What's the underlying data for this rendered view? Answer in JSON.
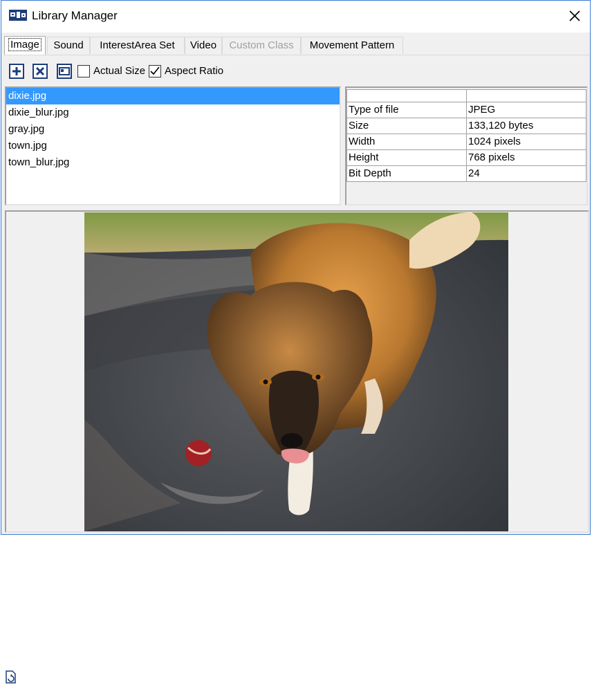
{
  "window": {
    "title": "Library Manager",
    "icons": {
      "app": "library-window-icon",
      "close": "close-icon"
    },
    "accent": "#3a7bd5"
  },
  "tabs": [
    {
      "label": "Image",
      "active": true
    },
    {
      "label": "Sound"
    },
    {
      "label": "InterestArea Set"
    },
    {
      "label": "Video"
    },
    {
      "label": "Custom Class",
      "disabled": true
    },
    {
      "label": "Movement Pattern"
    }
  ],
  "toolbar": {
    "add_icon": "plus-box-icon",
    "delete_icon": "x-box-icon",
    "view_icon": "window-icon",
    "actual_size_label": "Actual Size",
    "actual_size_checked": false,
    "aspect_ratio_label": "Aspect Ratio",
    "aspect_ratio_checked": true
  },
  "files": {
    "selected_index": 0,
    "selection_color": "#3399ff",
    "items": [
      "dixie.jpg",
      "dixie_blur.jpg",
      "gray.jpg",
      "town.jpg",
      "town_blur.jpg"
    ]
  },
  "properties": {
    "rows": [
      {
        "key": "Type of file",
        "value": "JPEG"
      },
      {
        "key": "Size",
        "value": "133,120 bytes"
      },
      {
        "key": "Width",
        "value": "1024 pixels"
      },
      {
        "key": "Height",
        "value": "768 pixels"
      },
      {
        "key": "Bit Depth",
        "value": "24"
      }
    ]
  },
  "preview": {
    "subject": "dog-photo"
  },
  "taskbar": {
    "icon": "document-refresh-icon"
  }
}
